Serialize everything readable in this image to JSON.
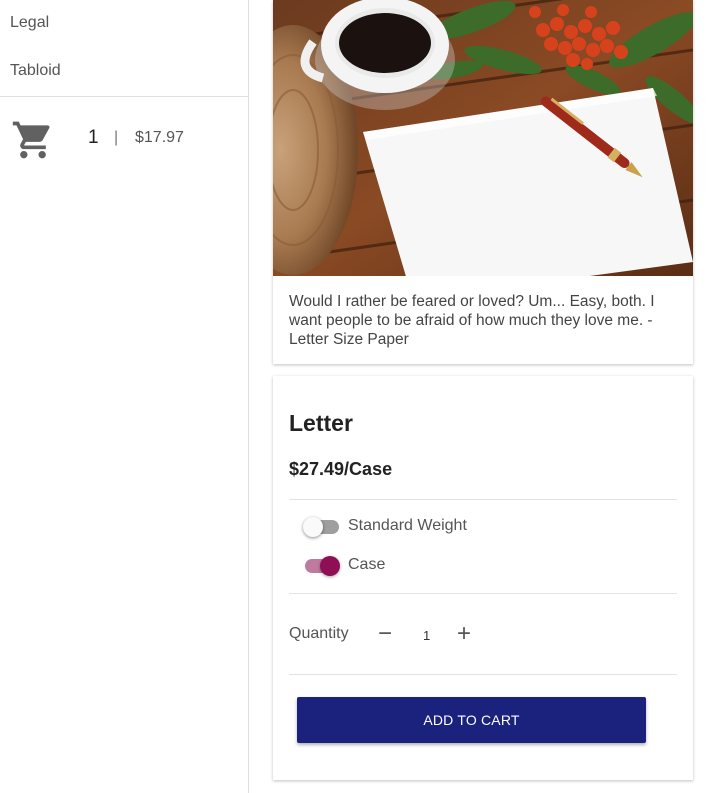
{
  "sidebar": {
    "items": [
      {
        "label": "Legal"
      },
      {
        "label": "Tabloid"
      }
    ],
    "cart": {
      "icon": "shopping-cart-icon",
      "count": "1",
      "separator": "|",
      "total": "$17.97"
    }
  },
  "feature": {
    "image": "coffee-paper-pen-photo",
    "quote": "Would I rather be feared or loved? Um... Easy, both. I want people to be afraid of how much they love me. -Letter Size Paper"
  },
  "product": {
    "name": "Letter",
    "price": "$27.49/Case",
    "options": [
      {
        "label": "Standard Weight",
        "on": false
      },
      {
        "label": "Case",
        "on": true
      }
    ],
    "quantity": {
      "label": "Quantity",
      "value": "1",
      "decrement": "−",
      "increment": "+"
    },
    "add_to_cart": "ADD TO CART"
  },
  "colors": {
    "accent_toggle": "#8e0f55",
    "button": "#1a227e"
  }
}
